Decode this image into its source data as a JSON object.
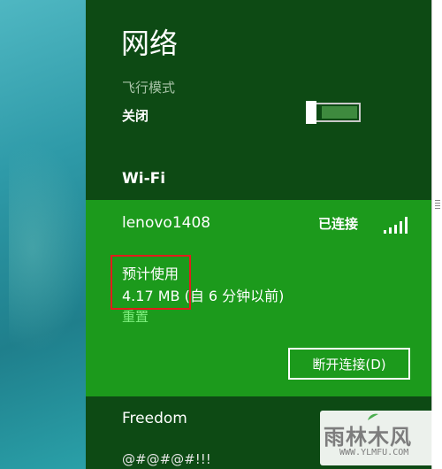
{
  "panel": {
    "title": "网络",
    "airplane_mode": {
      "label": "飞行模式",
      "state": "关闭",
      "on": false
    },
    "wifi_title": "Wi-Fi"
  },
  "networks": {
    "selected": {
      "name": "lenovo1408",
      "status": "已连接",
      "usage_label": "预计使用",
      "usage_value": "4.17 MB (自 6 分钟以前)",
      "reset_label": "重置",
      "disconnect_label": "断开连接(D)",
      "signal_bars": 5
    },
    "others": [
      {
        "name": "Freedom"
      },
      {
        "name": "@#@#@#!!!"
      }
    ]
  },
  "watermark": {
    "text": "雨林木风",
    "sub": "WWW.YLMFU.COM"
  },
  "colors": {
    "panel_bg": "#0d4a14",
    "selected_bg": "#1c9a1c",
    "highlight_box": "#e21c1c",
    "link": "#7ef07e"
  }
}
